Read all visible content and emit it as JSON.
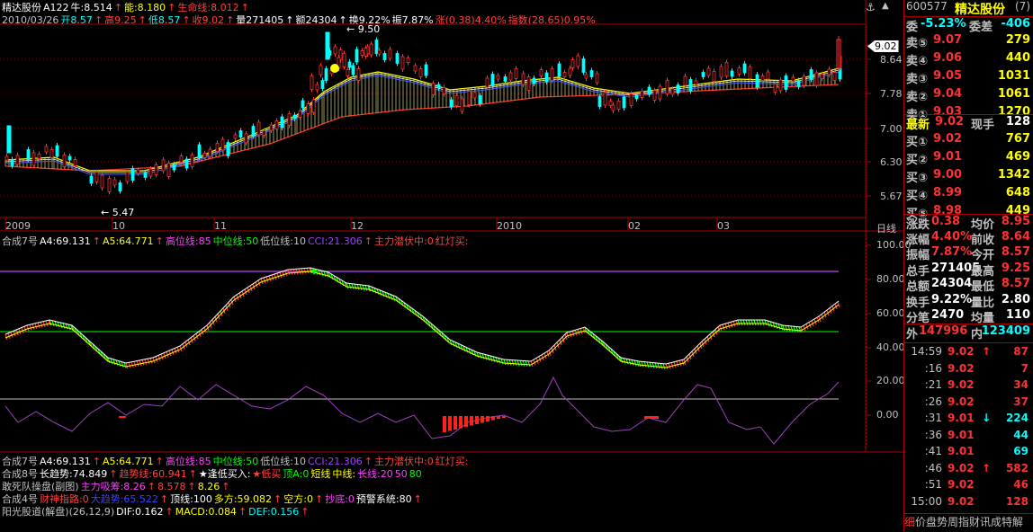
{
  "stock": {
    "name": "精达股份",
    "code": "A122",
    "date": "2010/03/26"
  },
  "header1": [
    {
      "t": "精达股份",
      "c": "#ffffff"
    },
    {
      "t": "A122",
      "c": "#ffffff"
    },
    {
      "t": "牛:8.514",
      "c": "#ffffff"
    },
    {
      "t": "↑",
      "c": "#ff4040"
    },
    {
      "t": "能:8.180",
      "c": "#ffff00"
    },
    {
      "t": "↑",
      "c": "#ff4040"
    },
    {
      "t": "生命线:8.012",
      "c": "#ff4040"
    },
    {
      "t": "↑",
      "c": "#ff4040"
    }
  ],
  "header2": [
    {
      "t": "2010/03/26",
      "c": "#c0c0c0"
    },
    {
      "t": "开8.57",
      "c": "#00ffff"
    },
    {
      "t": "↑",
      "c": "#ff4040"
    },
    {
      "t": "高9.25",
      "c": "#ff4040"
    },
    {
      "t": "↑",
      "c": "#ff4040"
    },
    {
      "t": "低8.57",
      "c": "#00ffff"
    },
    {
      "t": "↑",
      "c": "#ff4040"
    },
    {
      "t": "收9.02",
      "c": "#ff4040"
    },
    {
      "t": "↑",
      "c": "#ff4040"
    },
    {
      "t": "量271405",
      "c": "#ffffff"
    },
    {
      "t": "↑",
      "c": "#ffffff"
    },
    {
      "t": "额24304",
      "c": "#ffffff"
    },
    {
      "t": "↑",
      "c": "#ffffff"
    },
    {
      "t": "换9.22%",
      "c": "#ffffff"
    },
    {
      "t": "振7.87%",
      "c": "#ffffff"
    },
    {
      "t": "涨(0.38)4.40%",
      "c": "#ff4040"
    },
    {
      "t": "指数(28.65)0.95%",
      "c": "#ff4040"
    }
  ],
  "price_axis": [
    "9.02",
    "8.64",
    "7.78",
    "7.00",
    "6.30",
    "5.67"
  ],
  "price_annot": {
    "high": "9.50",
    "low": "5.47"
  },
  "date_axis": [
    "2009",
    "10",
    "11",
    "12",
    "2010",
    "02",
    "03"
  ],
  "period_label": "日线",
  "ind1_header": [
    {
      "t": "合成7号",
      "c": "#c0c0c0"
    },
    {
      "t": "A4:69.131",
      "c": "#ffffff"
    },
    {
      "t": "↑",
      "c": "#ff4040"
    },
    {
      "t": "A5:64.771",
      "c": "#ffff00"
    },
    {
      "t": "↑",
      "c": "#ff4040"
    },
    {
      "t": "高位线:85",
      "c": "#ff40ff"
    },
    {
      "t": "中位线:50",
      "c": "#00ff00"
    },
    {
      "t": "低位线:10",
      "c": "#c0c0c0"
    },
    {
      "t": "CCI:21.306",
      "c": "#a040ff"
    },
    {
      "t": "↑",
      "c": "#ff4040"
    },
    {
      "t": "主力潜伏中:0",
      "c": "#ff4040"
    },
    {
      "t": "红灯买:",
      "c": "#ff4040"
    }
  ],
  "ind_axis": [
    "100.00",
    "80.00",
    "60.00",
    "40.00",
    "20.00",
    "0.00"
  ],
  "bottom_lines": [
    [
      {
        "t": "合成7号",
        "c": "#c0c0c0"
      },
      {
        "t": "A4:69.131",
        "c": "#ffffff"
      },
      {
        "t": "↑",
        "c": "#ff4040"
      },
      {
        "t": "A5:64.771",
        "c": "#ffff00"
      },
      {
        "t": "↑",
        "c": "#ff4040"
      },
      {
        "t": "高位线:85",
        "c": "#ff40ff"
      },
      {
        "t": "中位线:50",
        "c": "#00ff00"
      },
      {
        "t": "低位线:10",
        "c": "#c0c0c0"
      },
      {
        "t": "CCI:21.306",
        "c": "#a040ff"
      },
      {
        "t": "↑",
        "c": "#ff4040"
      },
      {
        "t": "主力潜伏中:0",
        "c": "#ff4040"
      },
      {
        "t": "红灯买:",
        "c": "#ff4040"
      }
    ],
    [
      {
        "t": "合成8号",
        "c": "#c0c0c0"
      },
      {
        "t": "长趋势:74.849",
        "c": "#ffffff"
      },
      {
        "t": "↑",
        "c": "#ff4040"
      },
      {
        "t": "趋势线:60.941",
        "c": "#ff4040"
      },
      {
        "t": "↑",
        "c": "#ff4040"
      },
      {
        "t": "★逢低买入:",
        "c": "#ffffff"
      },
      {
        "t": "★低买",
        "c": "#ff4040"
      },
      {
        "t": "顶A:0",
        "c": "#00ff00"
      },
      {
        "t": "短线",
        "c": "#ffff00"
      },
      {
        "t": "中线:",
        "c": "#ffff00"
      },
      {
        "t": "长线:20",
        "c": "#ff40ff"
      },
      {
        "t": "50",
        "c": "#ff40ff"
      },
      {
        "t": "80",
        "c": "#00ff00"
      }
    ],
    [
      {
        "t": "敢死队操盘(副图)",
        "c": "#c0c0c0"
      },
      {
        "t": "主力吸筹:8.26",
        "c": "#ff40ff"
      },
      {
        "t": "↑",
        "c": "#ff4040"
      },
      {
        "t": "8.578",
        "c": "#ff4040"
      },
      {
        "t": "↑",
        "c": "#ff4040"
      },
      {
        "t": "8.26",
        "c": "#ffff00"
      },
      {
        "t": "↑",
        "c": "#ff4040"
      }
    ],
    [
      {
        "t": "合成4号",
        "c": "#c0c0c0"
      },
      {
        "t": "财神指路:0",
        "c": "#ff4040"
      },
      {
        "t": "大趋势:65.522",
        "c": "#4040ff"
      },
      {
        "t": "↑",
        "c": "#ff4040"
      },
      {
        "t": "顶线:100",
        "c": "#ffffff"
      },
      {
        "t": "多方:59.082",
        "c": "#ffff00"
      },
      {
        "t": "↑",
        "c": "#ff4040"
      },
      {
        "t": "空方:0",
        "c": "#ffff00"
      },
      {
        "t": "↑",
        "c": "#ff4040"
      },
      {
        "t": "抄底:0",
        "c": "#ff40ff"
      },
      {
        "t": "预警系统:80",
        "c": "#ffffff"
      },
      {
        "t": "↑",
        "c": "#ff4040"
      }
    ],
    [
      {
        "t": "阳光股道(解盘)(26,12,9)",
        "c": "#c0c0c0"
      },
      {
        "t": "DIF:0.162",
        "c": "#ffffff"
      },
      {
        "t": "↑",
        "c": "#ff4040"
      },
      {
        "t": "MACD:0.084",
        "c": "#ffff00"
      },
      {
        "t": "↑",
        "c": "#ff4040"
      },
      {
        "t": "DEF:0.156",
        "c": "#00ffff"
      },
      {
        "t": "↑",
        "c": "#ff4040"
      }
    ]
  ],
  "right": {
    "code": "600577",
    "name": "精达股份",
    "suffix": "(7)",
    "weibi_l": "委",
    "weibi_v": "-5.23%",
    "weicha_l": "委差",
    "weicha_v": "-406",
    "sells": [
      {
        "l": "卖⑤",
        "p": "9.07",
        "v": "279"
      },
      {
        "l": "卖④",
        "p": "9.06",
        "v": "440"
      },
      {
        "l": "卖③",
        "p": "9.05",
        "v": "1031"
      },
      {
        "l": "卖②",
        "p": "9.04",
        "v": "1061"
      },
      {
        "l": "卖①",
        "p": "9.03",
        "v": "1270"
      }
    ],
    "latest_l": "最新",
    "latest_v": "9.02",
    "hand_l": "现手",
    "hand_v": "128",
    "buys": [
      {
        "l": "买①",
        "p": "9.02",
        "v": "767"
      },
      {
        "l": "买②",
        "p": "9.01",
        "v": "469"
      },
      {
        "l": "买③",
        "p": "9.00",
        "v": "1342"
      },
      {
        "l": "买④",
        "p": "8.99",
        "v": "648"
      },
      {
        "l": "买⑤",
        "p": "8.98",
        "v": "449"
      }
    ],
    "stats": [
      {
        "l": "涨跌",
        "v": "0.38",
        "l2": "均价",
        "v2": "8.95"
      },
      {
        "l": "涨幅",
        "v": "4.40%",
        "l2": "前收",
        "v2": "8.64"
      },
      {
        "l": "振幅",
        "v": "7.87%",
        "l2": "今开",
        "v2": "8.57"
      },
      {
        "l": "总手",
        "v": "271405",
        "l2": "最高",
        "v2": "9.25"
      },
      {
        "l": "总额",
        "v": "24304",
        "l2": "最低",
        "v2": "8.57"
      },
      {
        "l": "换手",
        "v": "9.22%",
        "l2": "量比",
        "v2": "2.80"
      },
      {
        "l": "分笔",
        "v": "2470",
        "l2": "均量",
        "v2": "110"
      }
    ],
    "outer_l": "外",
    "outer_v": "147996",
    "inner_l": "内",
    "inner_v": "123409",
    "ticks": [
      {
        "t": "14:59",
        "p": "9.02",
        "a": "↑",
        "v": "87",
        "c": "#ff3030"
      },
      {
        "t": ":16",
        "p": "9.02",
        "a": "",
        "v": "7",
        "c": "#ff3030"
      },
      {
        "t": ":21",
        "p": "9.02",
        "a": "",
        "v": "34",
        "c": "#ff3030"
      },
      {
        "t": ":26",
        "p": "9.02",
        "a": "",
        "v": "37",
        "c": "#ff3030"
      },
      {
        "t": ":31",
        "p": "9.01",
        "a": "↓",
        "v": "224",
        "c": "#00ffff"
      },
      {
        "t": ":36",
        "p": "9.01",
        "a": "",
        "v": "44",
        "c": "#00ffff"
      },
      {
        "t": ":41",
        "p": "9.01",
        "a": "",
        "v": "69",
        "c": "#00ffff"
      },
      {
        "t": ":46",
        "p": "9.02",
        "a": "↑",
        "v": "582",
        "c": "#ff3030"
      },
      {
        "t": ":51",
        "p": "9.02",
        "a": "",
        "v": "46",
        "c": "#ff3030"
      },
      {
        "t": "15:00",
        "p": "9.02",
        "a": "",
        "v": "128",
        "c": "#ff3030"
      }
    ],
    "footer": "价盘势周指财讯成特解",
    "footer_l": "细"
  }
}
